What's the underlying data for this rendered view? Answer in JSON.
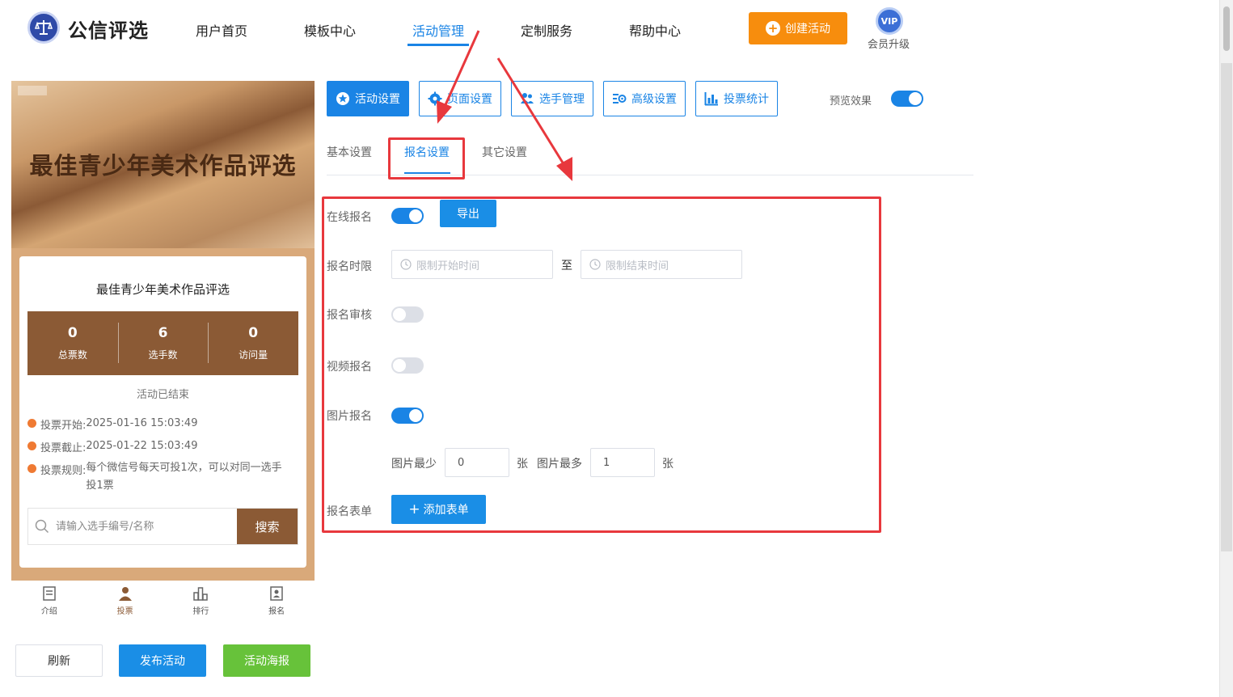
{
  "header": {
    "brand": "公信评选",
    "nav": [
      "用户首页",
      "模板中心",
      "活动管理",
      "定制服务",
      "帮助中心"
    ],
    "active_nav": "活动管理",
    "create_label": "创建活动",
    "vip_badge": "VIP",
    "vip_label": "会员升级"
  },
  "preview": {
    "banner_title": "最佳青少年美术作品评选",
    "card_title": "最佳青少年美术作品评选",
    "stats": [
      {
        "value": "0",
        "label": "总票数"
      },
      {
        "value": "6",
        "label": "选手数"
      },
      {
        "value": "0",
        "label": "访问量"
      }
    ],
    "status": "活动已结束",
    "info": [
      {
        "key": "投票开始:",
        "value": "2025-01-16 15:03:49"
      },
      {
        "key": "投票截止:",
        "value": "2025-01-22 15:03:49"
      },
      {
        "key": "投票规则:",
        "value": "每个微信号每天可投1次，可以对同一选手投1票"
      }
    ],
    "search_placeholder": "请输入选手编号/名称",
    "search_button": "搜索",
    "tabbar": [
      "介绍",
      "投票",
      "排行",
      "报名"
    ],
    "active_tab": "投票"
  },
  "actions": {
    "refresh": "刷新",
    "publish": "发布活动",
    "poster": "活动海报"
  },
  "settings": {
    "func_tabs": [
      "活动设置",
      "页面设置",
      "选手管理",
      "高级设置",
      "投票统计"
    ],
    "active_func_tab": "活动设置",
    "preview_label": "预览效果",
    "preview_on": true,
    "sub_tabs": [
      "基本设置",
      "报名设置",
      "其它设置"
    ],
    "active_sub_tab": "报名设置",
    "form": {
      "online_label": "在线报名",
      "online_on": true,
      "export_label": "导出",
      "period_label": "报名时限",
      "start_placeholder": "限制开始时间",
      "range_sep": "至",
      "end_placeholder": "限制结束时间",
      "review_label": "报名审核",
      "review_on": false,
      "video_label": "视频报名",
      "video_on": false,
      "image_label": "图片报名",
      "image_on": true,
      "image_min_label": "图片最少",
      "image_min_value": "0",
      "image_min_unit": "张",
      "image_max_label": "图片最多",
      "image_max_value": "1",
      "image_max_unit": "张",
      "form_label": "报名表单",
      "add_form_label": "添加表单"
    }
  },
  "colors": {
    "primary": "#1a84e5",
    "orange": "#f78d0d",
    "brown": "#8b5a35",
    "green": "#67c23a",
    "annotation_red": "#e8383d"
  }
}
